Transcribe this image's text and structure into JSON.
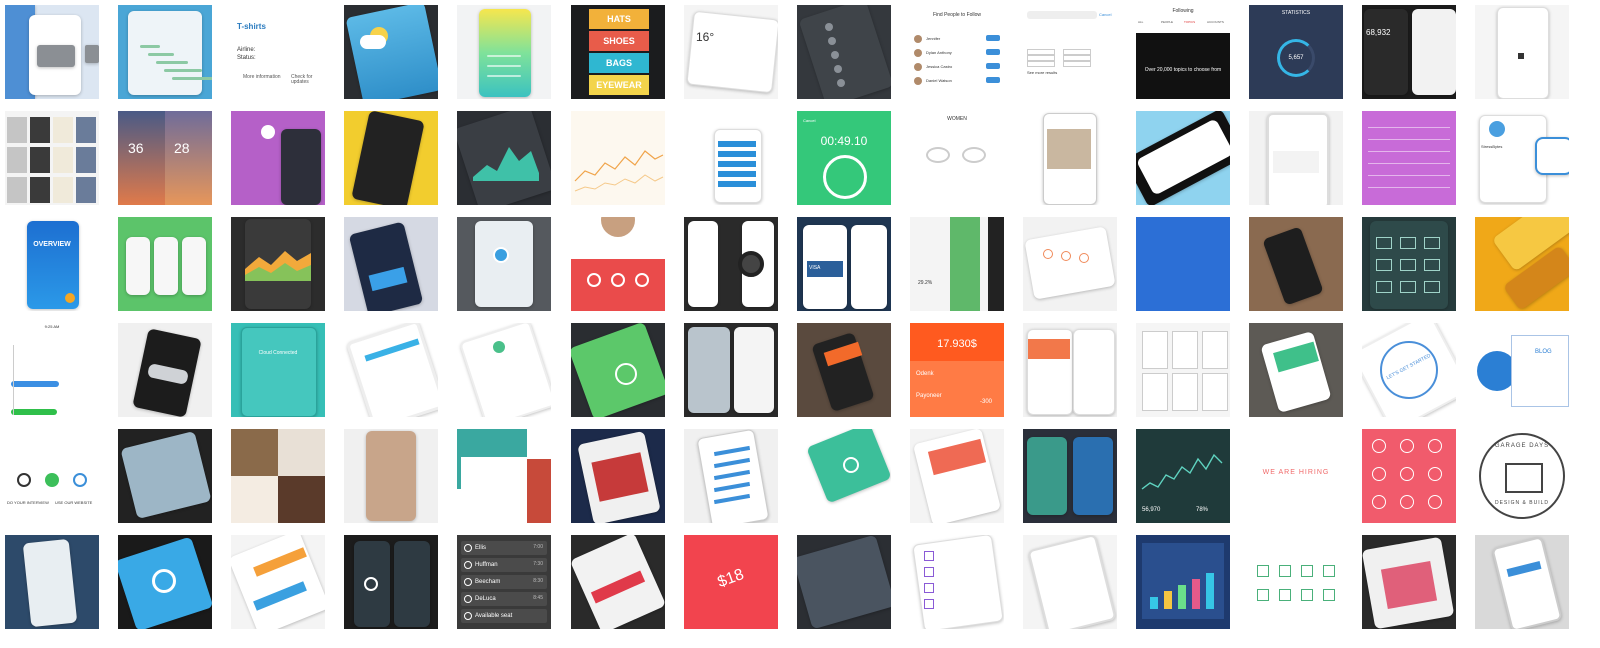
{
  "gallery": {
    "tiles": [
      {
        "id": "t-0-0",
        "bg": "#dce6f2",
        "kind": "sofa"
      },
      {
        "id": "t-0-1",
        "bg": "#4aa6d6",
        "kind": "phone-light"
      },
      {
        "id": "t-0-2",
        "bg": "#ffffff",
        "kind": "tshirts",
        "title": "T-shirts",
        "field1": "Airline:",
        "field2": "Status:",
        "footer1": "More information",
        "footer2": "Check for updates"
      },
      {
        "id": "t-0-3",
        "bg": "#2a2d31",
        "kind": "weather-cloud"
      },
      {
        "id": "t-0-4",
        "bg": "#f2f3f4",
        "kind": "gradient-phone"
      },
      {
        "id": "t-0-5",
        "bg": "#1b1c1e",
        "kind": "menu-stack",
        "items": [
          "HATS",
          "SHOES",
          "BAGS",
          "EYEWEAR"
        ]
      },
      {
        "id": "t-0-6",
        "bg": "#f4f4f4",
        "kind": "weather-widget",
        "temp": "16°"
      },
      {
        "id": "t-0-7",
        "bg": "#34383d",
        "kind": "dark-list"
      },
      {
        "id": "t-0-8",
        "bg": "#ffffff",
        "kind": "follow",
        "title": "Find People to Follow",
        "names": [
          "Jennifer",
          "Dylan Anthony",
          "Jessica Castro",
          "Daniel Watson"
        ],
        "btn": "Follow"
      },
      {
        "id": "t-0-9",
        "bg": "#ffffff",
        "kind": "search",
        "cancel": "Cancel",
        "more": "See more results"
      },
      {
        "id": "t-0-10",
        "bg": "#111111",
        "kind": "flipboard",
        "title": "Following",
        "tabs": [
          "ALL",
          "PEOPLE",
          "TOPICS",
          "ACCOUNTS"
        ],
        "text": "Over 20,000 topics to choose from"
      },
      {
        "id": "t-0-11",
        "bg": "#2d3b57",
        "kind": "stats",
        "title": "STATISTICS",
        "value": "5,657"
      },
      {
        "id": "t-0-12",
        "bg": "#1c1c1c",
        "kind": "numbers",
        "value": "68,932"
      },
      {
        "id": "t-0-13",
        "bg": "#f5f5f5",
        "kind": "phone-white"
      },
      {
        "id": "t-1-0",
        "bg": "#f4f4f4",
        "kind": "fashion-grid"
      },
      {
        "id": "t-1-1",
        "bg": "#3a4b6d",
        "kind": "weather-duo",
        "v1": "36",
        "v2": "28"
      },
      {
        "id": "t-1-2",
        "bg": "#b560c8",
        "kind": "purple-phones"
      },
      {
        "id": "t-1-3",
        "bg": "#f2cd2e",
        "kind": "yellow-phone"
      },
      {
        "id": "t-1-4",
        "bg": "#2b2e33",
        "kind": "area-chart-dark"
      },
      {
        "id": "t-1-5",
        "bg": "#fdf8ef",
        "kind": "line-chart-orange"
      },
      {
        "id": "t-1-6",
        "bg": "#ffffff",
        "kind": "blue-cards"
      },
      {
        "id": "t-1-7",
        "bg": "#34c87a",
        "kind": "timer",
        "value": "00:49.10",
        "label": "Cancel"
      },
      {
        "id": "t-1-8",
        "bg": "#ffffff",
        "kind": "glasses",
        "title": "WOMEN"
      },
      {
        "id": "t-1-9",
        "bg": "#ffffff",
        "kind": "food-phone"
      },
      {
        "id": "t-1-10",
        "bg": "#8fd3ef",
        "kind": "angled-phone"
      },
      {
        "id": "t-1-11",
        "bg": "#f2f2f2",
        "kind": "flight-phone"
      },
      {
        "id": "t-1-12",
        "bg": "#c86bd8",
        "kind": "purple-settings"
      },
      {
        "id": "t-1-13",
        "bg": "#ffffff",
        "kind": "app-icon",
        "label": "StressBytes"
      },
      {
        "id": "t-2-0",
        "bg": "#ffffff",
        "kind": "overview",
        "title": "OVERVIEW"
      },
      {
        "id": "t-2-1",
        "bg": "#5cc46a",
        "kind": "three-phones"
      },
      {
        "id": "t-2-2",
        "bg": "#2c2c2c",
        "kind": "orange-graph"
      },
      {
        "id": "t-2-3",
        "bg": "#d5d9e3",
        "kind": "hand-phone-blue"
      },
      {
        "id": "t-2-4",
        "bg": "#55595e",
        "kind": "map-phone"
      },
      {
        "id": "t-2-5",
        "bg": "#ffffff",
        "kind": "red-profile"
      },
      {
        "id": "t-2-6",
        "bg": "#2a2a2a",
        "kind": "watch-app"
      },
      {
        "id": "t-2-7",
        "bg": "#1f3652",
        "kind": "cards-dark",
        "label": "VISA"
      },
      {
        "id": "t-2-8",
        "bg": "#f4f4f4",
        "kind": "green-dashboard",
        "value": "29.2%"
      },
      {
        "id": "t-2-9",
        "bg": "#f2f2f2",
        "kind": "orange-icons"
      },
      {
        "id": "t-2-10",
        "bg": "#2c6fd6",
        "kind": "solid-blue"
      },
      {
        "id": "t-2-11",
        "bg": "#8a6a50",
        "kind": "hand-wood"
      },
      {
        "id": "t-2-12",
        "bg": "#263b3c",
        "kind": "icon-grid-dark"
      },
      {
        "id": "t-2-13",
        "bg": "#f0a818",
        "kind": "yellow-angle"
      },
      {
        "id": "t-3-0",
        "bg": "#ffffff",
        "kind": "chat-timeline",
        "time": "9:25 AM"
      },
      {
        "id": "t-3-1",
        "bg": "#f0f0f0",
        "kind": "car-phone"
      },
      {
        "id": "t-3-2",
        "bg": "#36bfb6",
        "kind": "cloud-teal",
        "title": "Cloud Connected"
      },
      {
        "id": "t-3-3",
        "bg": "#ffffff",
        "kind": "phone-cyan"
      },
      {
        "id": "t-3-4",
        "bg": "#ffffff",
        "kind": "phone-green-check"
      },
      {
        "id": "t-3-5",
        "bg": "#2a2d31",
        "kind": "green-phone-dark"
      },
      {
        "id": "t-3-6",
        "bg": "#2a2a2a",
        "kind": "photo-phones"
      },
      {
        "id": "t-3-7",
        "bg": "#5a4a3e",
        "kind": "hand-orange"
      },
      {
        "id": "t-3-8",
        "bg": "#ff5a1f",
        "kind": "orange-finance",
        "value": "17.930$",
        "row1": "Odenk",
        "row2": "Payoneer",
        "amt": "-300"
      },
      {
        "id": "t-3-9",
        "bg": "#f2f2f2",
        "kind": "orange-profile"
      },
      {
        "id": "t-3-10",
        "bg": "#f5f5f5",
        "kind": "wireframe"
      },
      {
        "id": "t-3-11",
        "bg": "#5d5a55",
        "kind": "green-hand"
      },
      {
        "id": "t-3-12",
        "bg": "#ffffff",
        "kind": "lets-get-started",
        "text": "LET'S GET STARTED"
      },
      {
        "id": "t-3-13",
        "bg": "#ffffff",
        "kind": "blog-illus",
        "text": "BLOG"
      },
      {
        "id": "t-4-0",
        "bg": "#ffffff",
        "kind": "wizard",
        "label1": "DO YOUR INTERVIEW",
        "label2": "USE OUR WEBSITE"
      },
      {
        "id": "t-4-1",
        "bg": "#222222",
        "kind": "boat-photo"
      },
      {
        "id": "t-4-2",
        "bg": "#b8442e",
        "kind": "food-collage"
      },
      {
        "id": "t-4-3",
        "bg": "#f0f0f0",
        "kind": "woman-phone"
      },
      {
        "id": "t-4-4",
        "bg": "#ffffff",
        "kind": "teal-red-layers"
      },
      {
        "id": "t-4-5",
        "bg": "#1c2a4a",
        "kind": "photo-cards"
      },
      {
        "id": "t-4-6",
        "bg": "#f0f0f0",
        "kind": "hand-list"
      },
      {
        "id": "t-4-7",
        "bg": "#ffffff",
        "kind": "teal-camera"
      },
      {
        "id": "t-4-8",
        "bg": "#f4f4f4",
        "kind": "coral-profile"
      },
      {
        "id": "t-4-9",
        "bg": "#2a2f3a",
        "kind": "shop-phones"
      },
      {
        "id": "t-4-10",
        "bg": "#1f3a3a",
        "kind": "performance-chart",
        "v1": "56,970",
        "v2": "78%"
      },
      {
        "id": "t-4-11",
        "bg": "#ffffff",
        "kind": "hiring",
        "text": "WE ARE HIRING"
      },
      {
        "id": "t-4-12",
        "bg": "#f15b6c",
        "kind": "coral-icons"
      },
      {
        "id": "t-4-13",
        "bg": "#ffffff",
        "kind": "garage-logo",
        "top": "GARAGE DAYS",
        "bottom": "DESIGN & BUILD"
      },
      {
        "id": "t-5-0",
        "bg": "#2d4a6a",
        "kind": "blue-device"
      },
      {
        "id": "t-5-1",
        "bg": "#1a1a1a",
        "kind": "blue-dash"
      },
      {
        "id": "t-5-2",
        "bg": "#f4f4f4",
        "kind": "orange-blue-form"
      },
      {
        "id": "t-5-3",
        "bg": "#1c1c1c",
        "kind": "dark-phones"
      },
      {
        "id": "t-5-4",
        "bg": "#3a3a3a",
        "kind": "schedule",
        "rows": [
          "Ellis",
          "Huffman",
          "Beecham",
          "DeLuca",
          "Available seat"
        ],
        "times": [
          "7:00",
          "7:30",
          "8:30",
          "8:45",
          ""
        ]
      },
      {
        "id": "t-5-5",
        "bg": "#2a2a2a",
        "kind": "red-cards-dark"
      },
      {
        "id": "t-5-6",
        "bg": "#f2444e",
        "kind": "price-red",
        "value": "$18"
      },
      {
        "id": "t-5-7",
        "bg": "#2b2e33",
        "kind": "aerial"
      },
      {
        "id": "t-5-8",
        "bg": "#ffffff",
        "kind": "checklist"
      },
      {
        "id": "t-5-9",
        "bg": "#f4f4f4",
        "kind": "white-phone-grid"
      },
      {
        "id": "t-5-10",
        "bg": "#1e3a6e",
        "kind": "blue-analytics"
      },
      {
        "id": "t-5-11",
        "bg": "#ffffff",
        "kind": "line-icons"
      },
      {
        "id": "t-5-12",
        "bg": "#2a2a2a",
        "kind": "shop-collage"
      },
      {
        "id": "t-5-13",
        "bg": "#d9d9d9",
        "kind": "hand-white-phone"
      }
    ]
  }
}
